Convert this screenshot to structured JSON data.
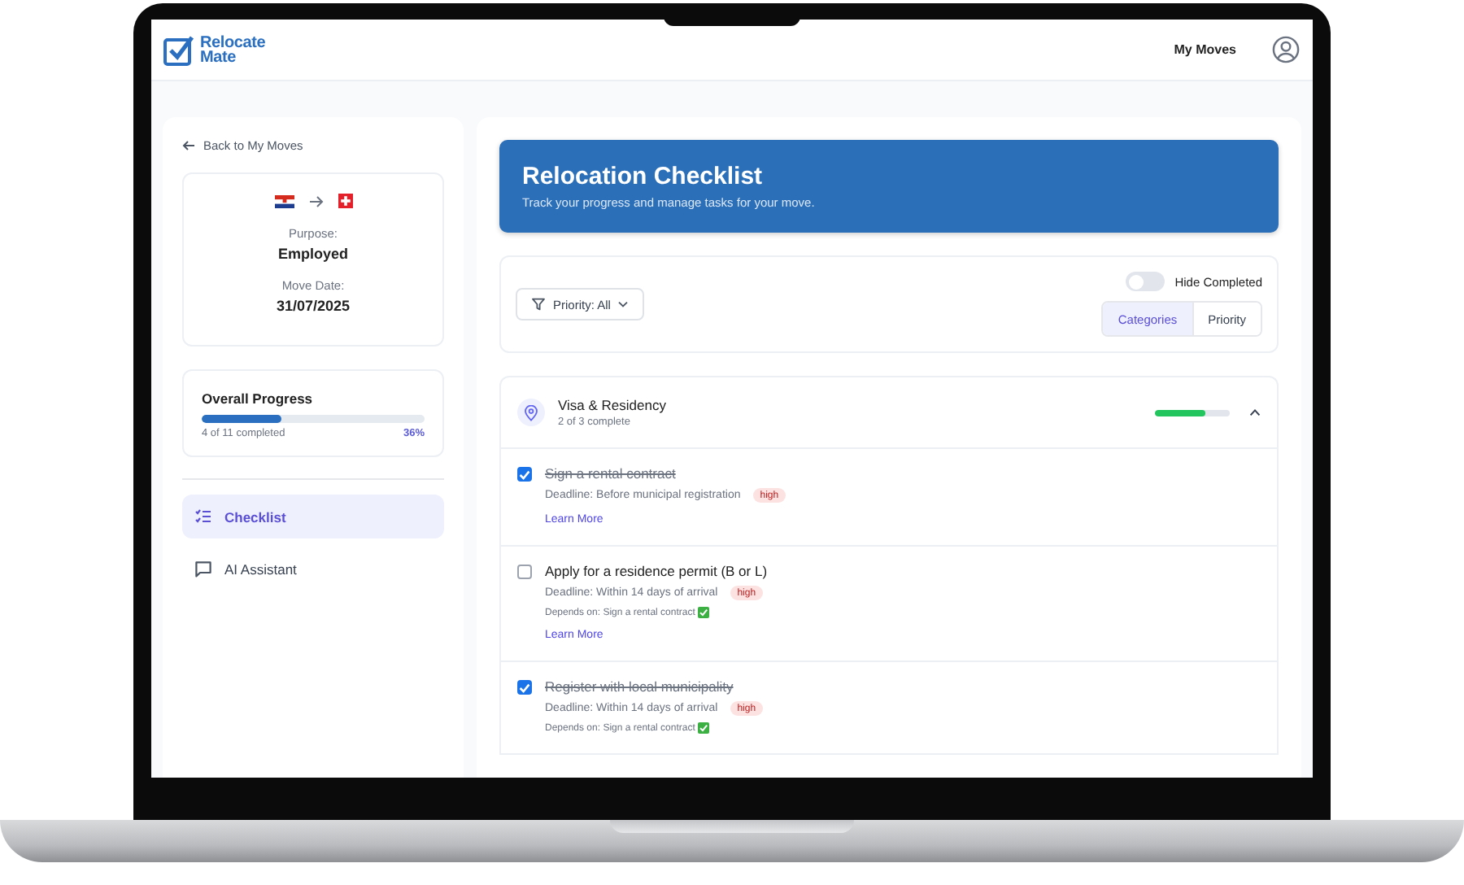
{
  "topbar": {
    "logo_text": "Relocate Mate",
    "nav_link": "My Moves"
  },
  "sidebar": {
    "back_link": "Back to My Moves",
    "move": {
      "purpose_label": "Purpose:",
      "purpose": "Employed",
      "date_label": "Move Date:",
      "date": "31/07/2025"
    },
    "progress": {
      "title": "Overall Progress",
      "level": 0.36,
      "summary": "4 of 11 completed",
      "percent": "36%"
    },
    "items": [
      {
        "label": "Checklist",
        "kind": "checklist",
        "selected": true
      },
      {
        "label": "AI Assistant",
        "kind": "chat",
        "selected": false
      }
    ]
  },
  "header": {
    "title": "Relocation Checklist",
    "subtitle": "Track your progress and manage tasks for your move."
  },
  "filters": {
    "priority_filter": "Priority: All",
    "hide_completed": {
      "label": "Hide Completed",
      "on": false
    },
    "view_tabs": [
      {
        "label": "Categories",
        "selected": true
      },
      {
        "label": "Priority",
        "selected": false
      }
    ]
  },
  "categories": [
    {
      "name": "Visa & Residency",
      "summary": "2 of 3 complete",
      "level": 0.67,
      "expanded": true,
      "tasks": [
        {
          "title": "Sign a rental contract",
          "checked": true,
          "deadline": "Deadline: Before municipal registration",
          "priority": "high",
          "learn_more": "Learn More"
        },
        {
          "title": "Apply for a residence permit (B or L)",
          "checked": false,
          "deadline": "Deadline: Within 14 days of arrival",
          "priority": "high",
          "depends_on": "Depends on: Sign a rental contract",
          "dependency_met": true,
          "learn_more": "Learn More"
        },
        {
          "title": "Register with local municipality",
          "checked": true,
          "deadline": "Deadline: Within 14 days of arrival",
          "priority": "high",
          "depends_on": "Depends on: Sign a rental contract",
          "dependency_met": true
        }
      ]
    }
  ]
}
